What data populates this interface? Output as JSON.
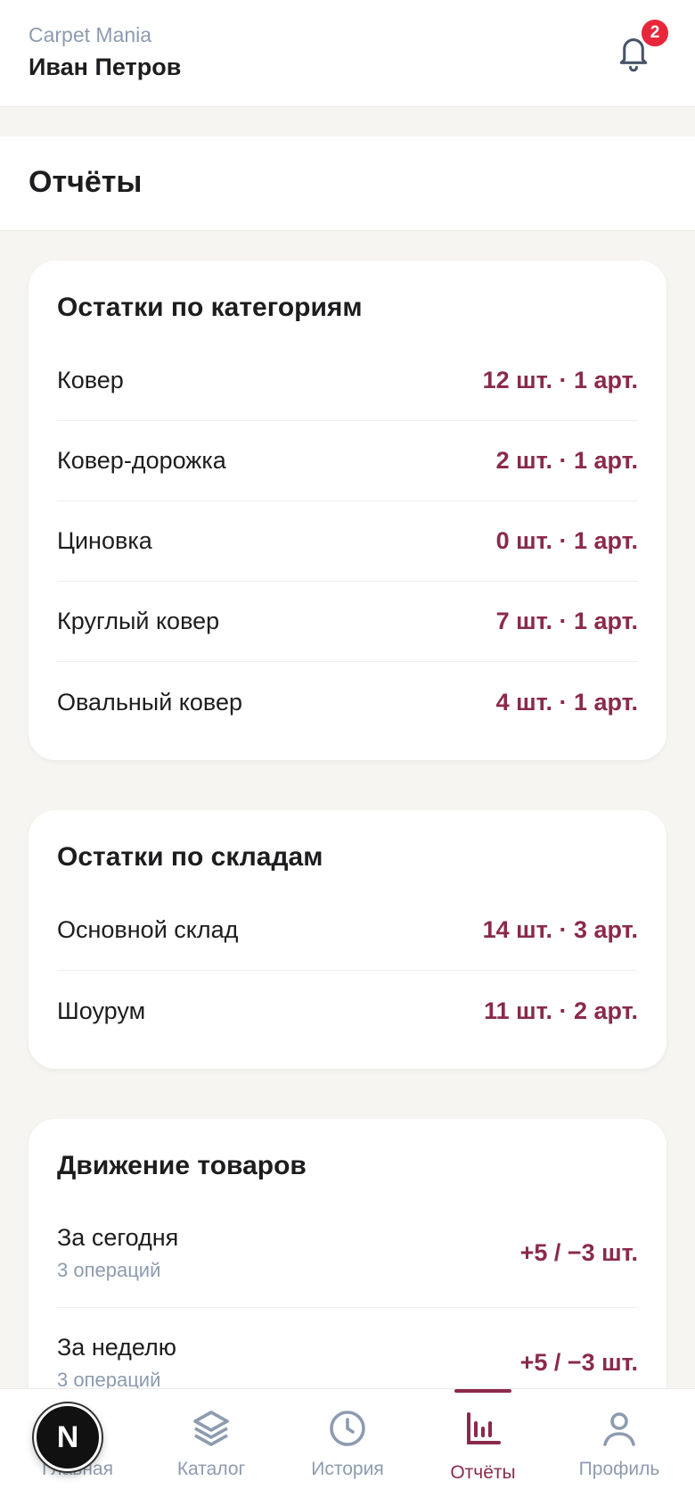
{
  "header": {
    "brand": "Carpet Mania",
    "user_name": "Иван Петров",
    "notification_count": "2"
  },
  "page": {
    "title": "Отчёты"
  },
  "categories_card": {
    "title": "Остатки по категориям",
    "rows": [
      {
        "label": "Ковер",
        "value": "12 шт. · 1 арт."
      },
      {
        "label": "Ковер-дорожка",
        "value": "2 шт. · 1 арт."
      },
      {
        "label": "Циновка",
        "value": "0 шт. · 1 арт."
      },
      {
        "label": "Круглый ковер",
        "value": "7 шт. · 1 арт."
      },
      {
        "label": "Овальный ковер",
        "value": "4 шт. · 1 арт."
      }
    ]
  },
  "warehouses_card": {
    "title": "Остатки по складам",
    "rows": [
      {
        "label": "Основной склад",
        "value": "14 шт. · 3 арт."
      },
      {
        "label": "Шоурум",
        "value": "11 шт. · 2 арт."
      }
    ]
  },
  "movement_card": {
    "title": "Движение товаров",
    "rows": [
      {
        "label": "За сегодня",
        "sub": "3 операций",
        "value": "+5 / −3 шт."
      },
      {
        "label": "За неделю",
        "sub": "3 операций",
        "value": "+5 / −3 шт."
      }
    ]
  },
  "bottom_nav": {
    "items": [
      {
        "label": "Главная",
        "icon": "home-icon"
      },
      {
        "label": "Каталог",
        "icon": "layers-icon"
      },
      {
        "label": "История",
        "icon": "clock-icon"
      },
      {
        "label": "Отчёты",
        "icon": "bar-chart-icon",
        "active": true
      },
      {
        "label": "Профиль",
        "icon": "user-icon"
      }
    ],
    "fab_letter": "N"
  },
  "colors": {
    "accent": "#8a2a4a",
    "muted": "#8d9bb0",
    "badge": "#e8273b",
    "background": "#f6f5f2"
  }
}
